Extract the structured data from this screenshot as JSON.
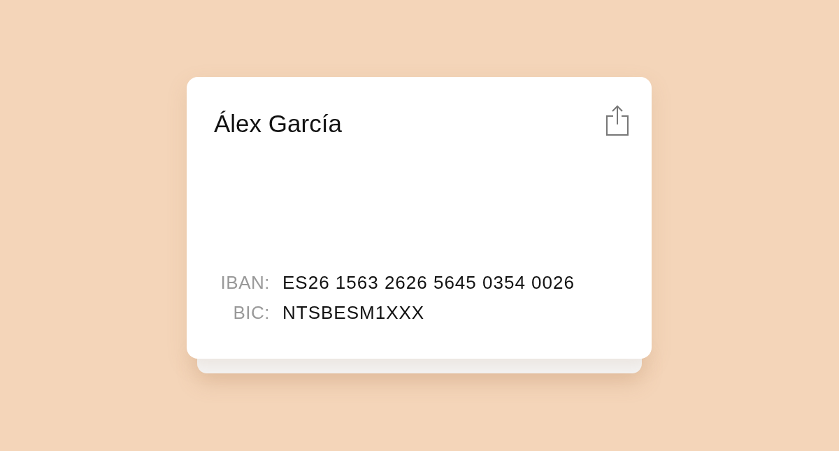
{
  "card": {
    "name": "Álex García",
    "fields": [
      {
        "label": "IBAN:",
        "value": "ES26 1563 2626 5645 0354 0026"
      },
      {
        "label": "BIC:",
        "value": "NTSBESM1XXX"
      }
    ]
  }
}
